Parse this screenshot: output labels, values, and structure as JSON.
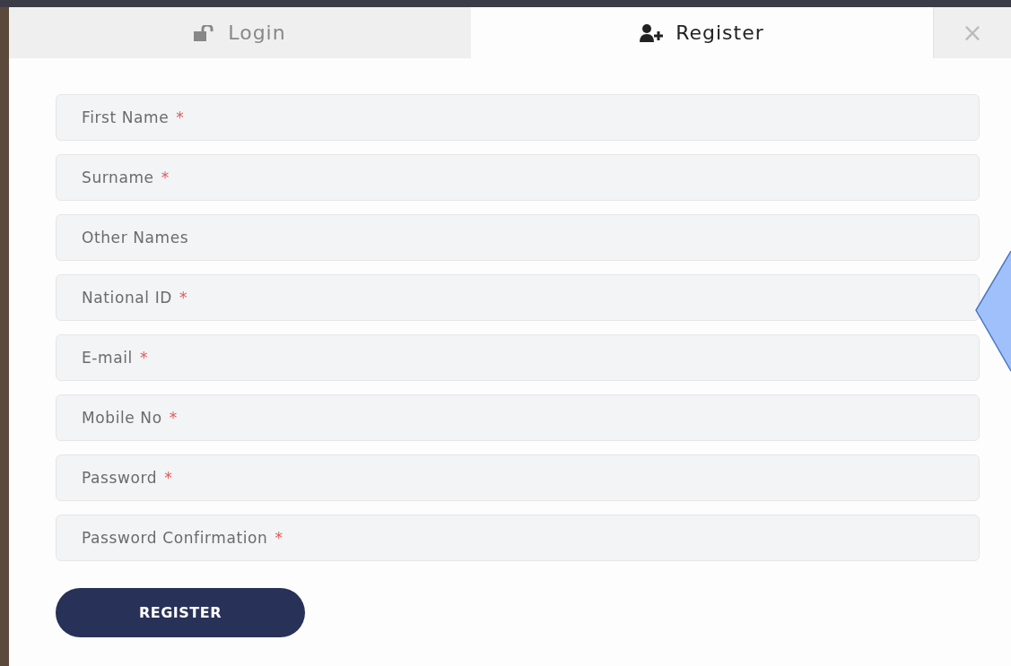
{
  "tabs": [
    {
      "label": "Login",
      "selected": false
    },
    {
      "label": "Register",
      "selected": true
    }
  ],
  "close": {
    "label": "×"
  },
  "fields": [
    {
      "placeholder": "First Name",
      "required_mark": "*"
    },
    {
      "placeholder": "Surname",
      "required_mark": "*"
    },
    {
      "placeholder": "Other Names"
    },
    {
      "placeholder": "National ID",
      "required_mark": "*"
    },
    {
      "placeholder": "E-mail",
      "required_mark": "*"
    },
    {
      "placeholder": "Mobile No",
      "required_mark": "*"
    },
    {
      "placeholder": "Password",
      "required_mark": "*"
    },
    {
      "placeholder": "Password Confirmation",
      "required_mark": "*"
    }
  ],
  "submit": {
    "label": "REGISTER"
  }
}
